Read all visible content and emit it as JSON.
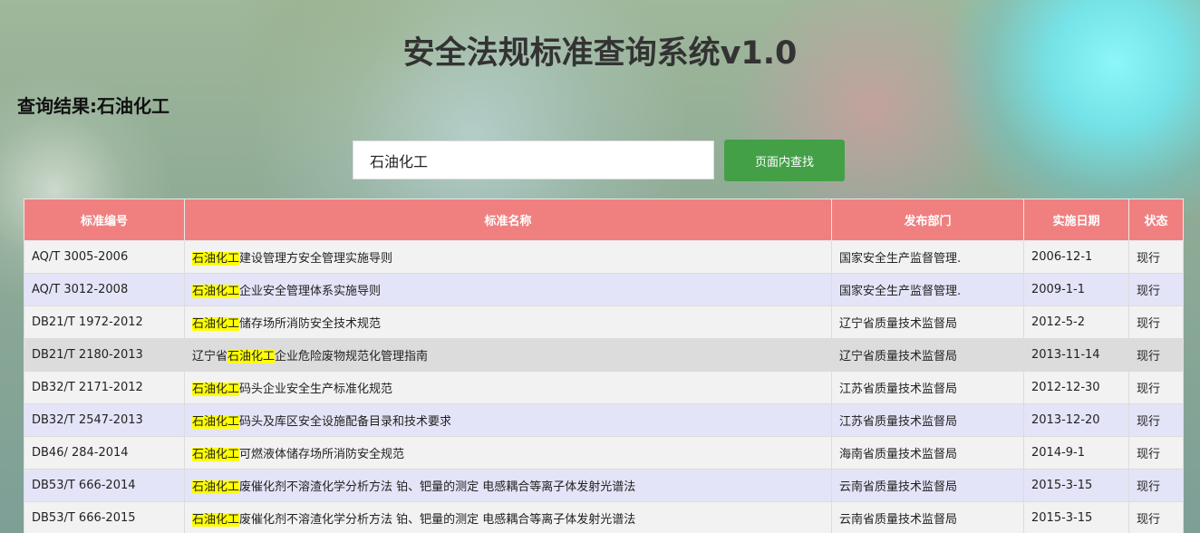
{
  "header": {
    "title": "安全法规标准查询系统v1.0",
    "result_label": "查询结果:石油化工"
  },
  "search": {
    "value": "石油化工",
    "button_label": "页面内查找"
  },
  "highlight_term": "石油化工",
  "colors": {
    "header_bg": "#f08080",
    "button_bg": "#43a047",
    "highlight": "#ffff00",
    "row_odd": "#f2f2f2",
    "row_even": "#e4e4f8",
    "row_hover": "#dcdcdc"
  },
  "table": {
    "columns": [
      "标准编号",
      "标准名称",
      "发布部门",
      "实施日期",
      "状态"
    ],
    "rows": [
      {
        "code": "AQ/T 3005-2006",
        "name": "石油化工建设管理方安全管理实施导则",
        "dept": "国家安全生产监督管理.",
        "date": "2006-12-1",
        "status": "现行"
      },
      {
        "code": "AQ/T 3012-2008",
        "name": "石油化工企业安全管理体系实施导则",
        "dept": "国家安全生产监督管理.",
        "date": "2009-1-1",
        "status": "现行"
      },
      {
        "code": "DB21/T 1972-2012",
        "name": "石油化工储存场所消防安全技术规范",
        "dept": "辽宁省质量技术监督局",
        "date": "2012-5-2",
        "status": "现行"
      },
      {
        "code": "DB21/T 2180-2013",
        "name": "辽宁省石油化工企业危险废物规范化管理指南",
        "dept": "辽宁省质量技术监督局",
        "date": "2013-11-14",
        "status": "现行"
      },
      {
        "code": "DB32/T 2171-2012",
        "name": "石油化工码头企业安全生产标准化规范",
        "dept": "江苏省质量技术监督局",
        "date": "2012-12-30",
        "status": "现行"
      },
      {
        "code": "DB32/T 2547-2013",
        "name": "石油化工码头及库区安全设施配备目录和技术要求",
        "dept": "江苏省质量技术监督局",
        "date": "2013-12-20",
        "status": "现行"
      },
      {
        "code": "DB46/ 284-2014",
        "name": "石油化工可燃液体储存场所消防安全规范",
        "dept": "海南省质量技术监督局",
        "date": "2014-9-1",
        "status": "现行"
      },
      {
        "code": "DB53/T 666-2014",
        "name": "石油化工废催化剂不溶渣化学分析方法 铂、钯量的测定 电感耦合等离子体发射光谱法",
        "dept": "云南省质量技术监督局",
        "date": "2015-3-15",
        "status": "现行"
      },
      {
        "code": "DB53/T 666-2015",
        "name": "石油化工废催化剂不溶渣化学分析方法 铂、钯量的测定 电感耦合等离子体发射光谱法",
        "dept": "云南省质量技术监督局",
        "date": "2015-3-15",
        "status": "现行"
      }
    ]
  }
}
